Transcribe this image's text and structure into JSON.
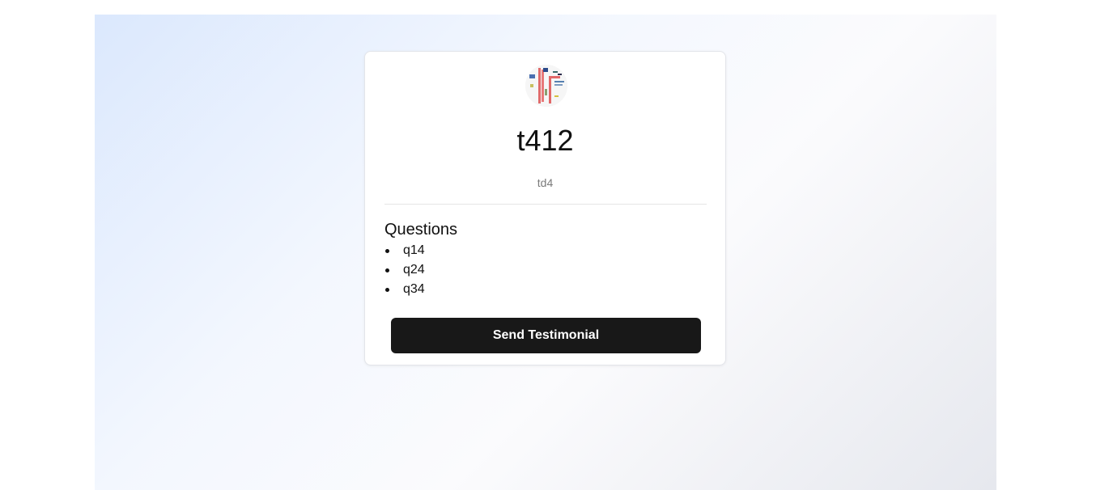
{
  "space": {
    "title": "t412",
    "description": "td4"
  },
  "questions": {
    "heading": "Questions",
    "items": [
      "q14",
      "q24",
      "q34"
    ]
  },
  "actions": {
    "send_label": "Send Testimonial"
  },
  "colors": {
    "button_bg": "#181818",
    "button_text": "#ffffff",
    "bg_gradient_start": "#dbe8fd",
    "bg_gradient_end": "#e6e8ee"
  },
  "icons": {
    "logo": "space-logo-icon"
  }
}
